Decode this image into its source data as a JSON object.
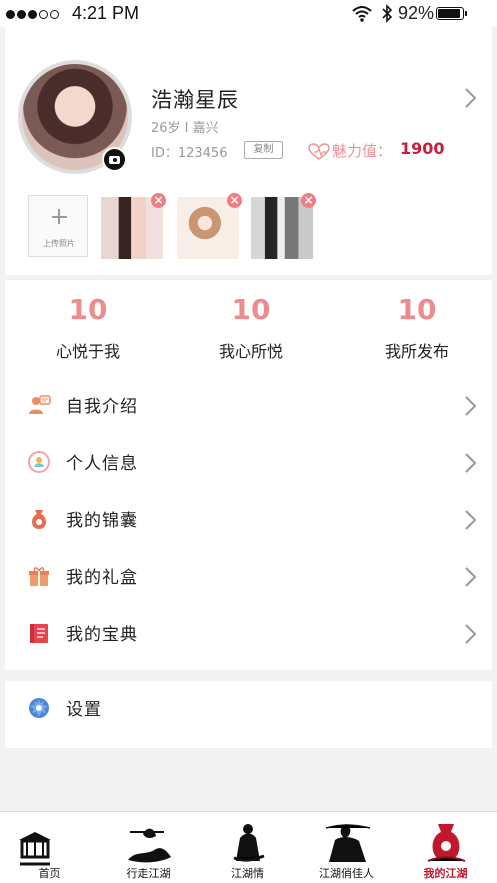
{
  "status": {
    "carrier_dots": "●●●○○",
    "time": "4:21 PM",
    "battery_percent": "92%",
    "battery_level": 0.92,
    "icons": [
      "wifi-icon",
      "bluetooth-icon",
      "battery-icon"
    ]
  },
  "profile": {
    "name": "浩瀚星辰",
    "meta": "26岁 I 嘉兴",
    "id_text": "ID：123456",
    "copy_label": "复制",
    "charm_label": "魅力值：",
    "charm_value": "1900",
    "upload_label": "上传照片",
    "photo_count": 3
  },
  "stats": [
    {
      "value": "10",
      "label": "心悦于我"
    },
    {
      "value": "10",
      "label": "我心所悦"
    },
    {
      "value": "10",
      "label": "我所发布"
    }
  ],
  "menu": [
    {
      "label": "自我介绍",
      "icon": "profile-card-icon"
    },
    {
      "label": "个人信息",
      "icon": "person-info-icon"
    },
    {
      "label": "我的锦囊",
      "icon": "pouch-icon"
    },
    {
      "label": "我的礼盒",
      "icon": "gift-icon"
    },
    {
      "label": "我的宝典",
      "icon": "book-icon"
    }
  ],
  "settings": {
    "label": "设置",
    "icon": "gear-icon"
  },
  "tabs": [
    {
      "label": "首页",
      "icon": "gatehouse-icon"
    },
    {
      "label": "行走江湖",
      "icon": "walking-wanderer-icon"
    },
    {
      "label": "江湖情",
      "icon": "ink-figure-icon"
    },
    {
      "label": "江湖俏佳人",
      "icon": "ink-lady-icon"
    },
    {
      "label": "我的江湖",
      "icon": "red-pouch-icon"
    }
  ],
  "colors": {
    "accent_pink": "#ec8c8f",
    "charm_red": "#c91f3d",
    "active_tab": "#c0182d",
    "background": "#f2f2f2"
  }
}
